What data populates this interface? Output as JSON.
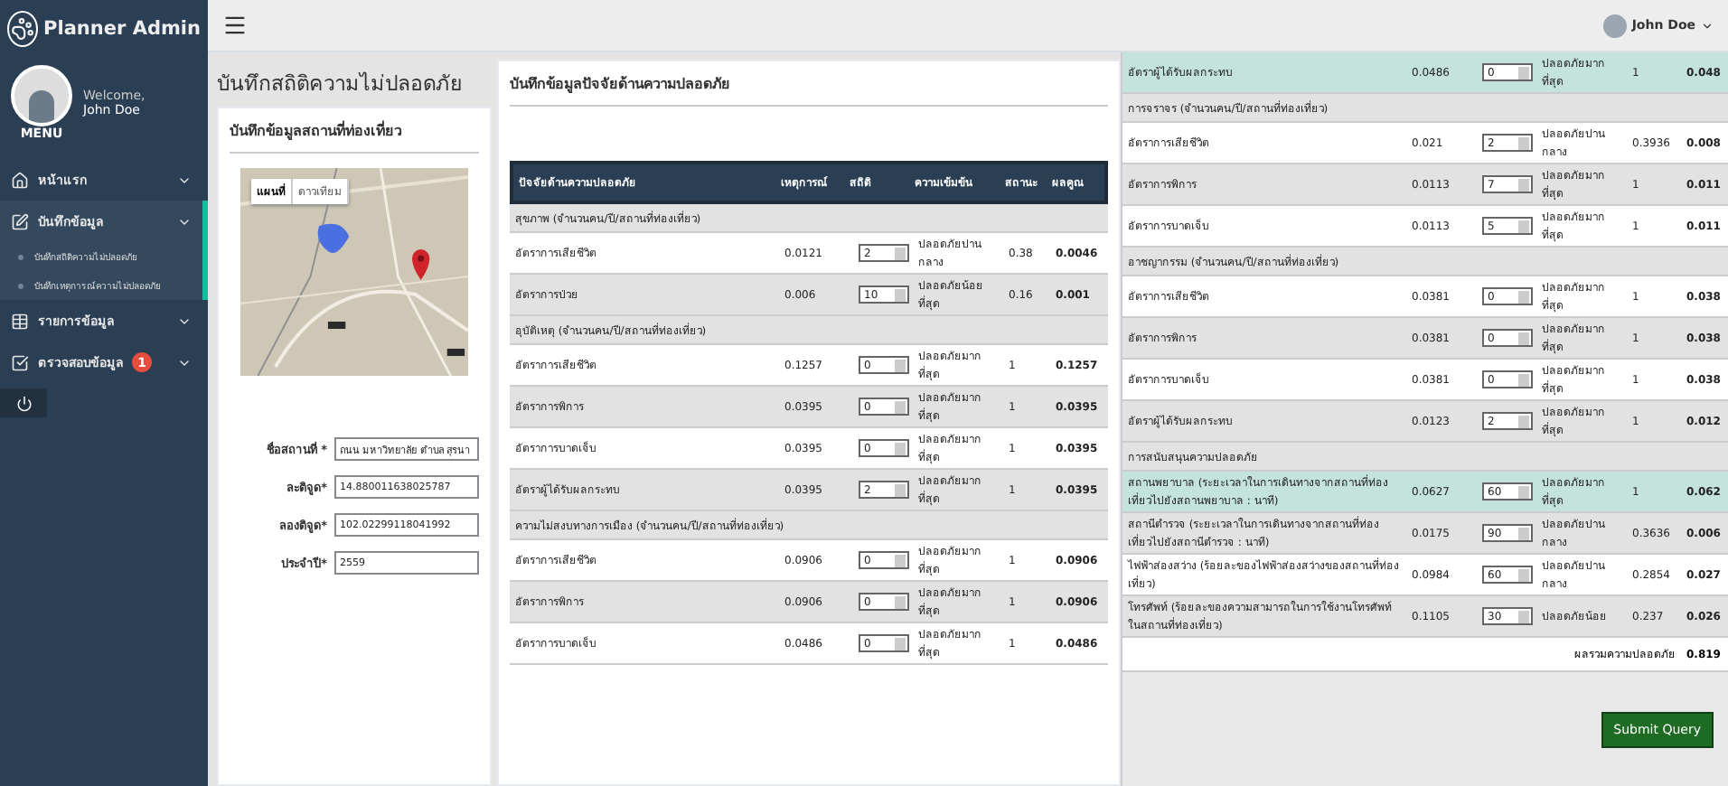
{
  "sidebar": {
    "brand": "Planner Admin",
    "welcome": "Welcome,",
    "user": "John Doe",
    "menu_label": "MENU",
    "items": [
      {
        "kind": "home",
        "label": "หน้าแรก",
        "selected": false
      },
      {
        "kind": "edit",
        "label": "บันทึกข้อมูล",
        "selected": true,
        "children": [
          {
            "label": "บันทึกสถิติความไม่ปลอดภัย"
          },
          {
            "label": "บันทึกเหตุการณ์ความไม่ปลอดภัย"
          }
        ]
      },
      {
        "kind": "table",
        "label": "รายการข้อมูล",
        "selected": false
      },
      {
        "kind": "check",
        "label": "ตรวจสอบข้อมูล",
        "badge": "1",
        "selected": false
      }
    ]
  },
  "topbar": {
    "user": "John Doe"
  },
  "page_title": "บันทึกสถิติความไม่ปลอดภัย",
  "location_card": {
    "title": "บันทึกข้อมูลสถานที่ท่องเที่ยว",
    "map": {
      "kind": "picture",
      "tabs": [
        {
          "label": "แผนที่",
          "selected": true
        },
        {
          "label": "ดาวเทียม",
          "selected": false
        }
      ]
    },
    "fields": [
      {
        "label": "ชื่อสถานที่ *",
        "value": "ถนน มหาวิทยาลัย ตำบล สุรนา"
      },
      {
        "label": "ละติจูด*",
        "value": "14.880011638025787"
      },
      {
        "label": "ลองติจูด*",
        "value": "102.02299118041992"
      },
      {
        "label": "ประจำปี*",
        "value": "2559"
      }
    ]
  },
  "factors_table": {
    "title": "บันทึกข้อมูลปัจจัยด้านความปลอดภัย",
    "columns": [
      "ปัจจัยด้านความปลอดภัย",
      "เหตุการณ์",
      "สถิติ",
      "ความเข้มข้น",
      "สถานะ",
      "ผลคูณ"
    ],
    "rows": [
      {
        "kind": "group",
        "label": "สุขภาพ (จำนวนคน/ปี/สถานที่ท่องเที่ยว)"
      },
      {
        "kind": "item",
        "factor": "อัตราการเสียชีวิต",
        "weight": "0.0121",
        "stat": "2",
        "intensity": "ปลอดภัยปานกลาง",
        "score": "0.38",
        "product": "0.0046",
        "highlighted": false
      },
      {
        "kind": "item",
        "factor": "อัตราการป่วย",
        "weight": "0.006",
        "stat": "10",
        "intensity": "ปลอดภัยน้อยที่สุด",
        "score": "0.16",
        "product": "0.001",
        "highlighted": false
      },
      {
        "kind": "group",
        "label": "อุบัติเหตุ (จำนวนคน/ปี/สถานที่ท่องเที่ยว)"
      },
      {
        "kind": "item",
        "factor": "อัตราการเสียชีวิต",
        "weight": "0.1257",
        "stat": "0",
        "intensity": "ปลอดภัยมากที่สุด",
        "score": "1",
        "product": "0.1257",
        "highlighted": false
      },
      {
        "kind": "item",
        "factor": "อัตราการพิการ",
        "weight": "0.0395",
        "stat": "0",
        "intensity": "ปลอดภัยมากที่สุด",
        "score": "1",
        "product": "0.0395",
        "highlighted": false
      },
      {
        "kind": "item",
        "factor": "อัตราการบาดเจ็บ",
        "weight": "0.0395",
        "stat": "0",
        "intensity": "ปลอดภัยมากที่สุด",
        "score": "1",
        "product": "0.0395",
        "highlighted": false
      },
      {
        "kind": "item",
        "factor": "อัตราผู้ได้รับผลกระทบ",
        "weight": "0.0395",
        "stat": "2",
        "intensity": "ปลอดภัยมากที่สุด",
        "score": "1",
        "product": "0.0395",
        "highlighted": false
      },
      {
        "kind": "group",
        "label": "ความไม่สงบทางการเมือง (จำนวนคน/ปี/สถานที่ท่องเที่ยว)"
      },
      {
        "kind": "item",
        "factor": "อัตราการเสียชีวิต",
        "weight": "0.0906",
        "stat": "0",
        "intensity": "ปลอดภัยมากที่สุด",
        "score": "1",
        "product": "0.0906",
        "highlighted": false
      },
      {
        "kind": "item",
        "factor": "อัตราการพิการ",
        "weight": "0.0906",
        "stat": "0",
        "intensity": "ปลอดภัยมากที่สุด",
        "score": "1",
        "product": "0.0906",
        "highlighted": false
      },
      {
        "kind": "item",
        "factor": "อัตราการบาดเจ็บ",
        "weight": "0.0486",
        "stat": "0",
        "intensity": "ปลอดภัยมากที่สุด",
        "score": "1",
        "product": "0.0486",
        "highlighted": false
      }
    ]
  },
  "factors_table_continued": {
    "rows": [
      {
        "kind": "item",
        "factor": "อัตราผู้ได้รับผลกระทบ",
        "weight": "0.0486",
        "stat": "0",
        "intensity": "ปลอดภัยมากที่สุด",
        "score": "1",
        "product": "0.048",
        "highlighted": true
      },
      {
        "kind": "group",
        "label": "การจราจร (จำนวนคน/ปี/สถานที่ท่องเที่ยว)"
      },
      {
        "kind": "item",
        "factor": "อัตราการเสียชีวิต",
        "weight": "0.021",
        "stat": "2",
        "intensity": "ปลอดภัยปานกลาง",
        "score": "0.3936",
        "product": "0.008",
        "highlighted": false
      },
      {
        "kind": "item",
        "factor": "อัตราการพิการ",
        "weight": "0.0113",
        "stat": "7",
        "intensity": "ปลอดภัยมากที่สุด",
        "score": "1",
        "product": "0.011",
        "highlighted": false
      },
      {
        "kind": "item",
        "factor": "อัตราการบาดเจ็บ",
        "weight": "0.0113",
        "stat": "5",
        "intensity": "ปลอดภัยมากที่สุด",
        "score": "1",
        "product": "0.011",
        "highlighted": false
      },
      {
        "kind": "group",
        "label": "อาชญากรรม (จำนวนคน/ปี/สถานที่ท่องเที่ยว)"
      },
      {
        "kind": "item",
        "factor": "อัตราการเสียชีวิต",
        "weight": "0.0381",
        "stat": "0",
        "intensity": "ปลอดภัยมากที่สุด",
        "score": "1",
        "product": "0.038",
        "highlighted": false
      },
      {
        "kind": "item",
        "factor": "อัตราการพิการ",
        "weight": "0.0381",
        "stat": "0",
        "intensity": "ปลอดภัยมากที่สุด",
        "score": "1",
        "product": "0.038",
        "highlighted": false
      },
      {
        "kind": "item",
        "factor": "อัตราการบาดเจ็บ",
        "weight": "0.0381",
        "stat": "0",
        "intensity": "ปลอดภัยมากที่สุด",
        "score": "1",
        "product": "0.038",
        "highlighted": false
      },
      {
        "kind": "item",
        "factor": "อัตราผู้ได้รับผลกระทบ",
        "weight": "0.0123",
        "stat": "2",
        "intensity": "ปลอดภัยมากที่สุด",
        "score": "1",
        "product": "0.012",
        "highlighted": false
      },
      {
        "kind": "group",
        "label": "การสนับสนุนความปลอดภัย"
      },
      {
        "kind": "item",
        "factor": "สถานพยาบาล (ระยะเวลาในการเดินทางจากสถานที่ท่องเที่ยวไปยังสถานพยาบาล : นาที)",
        "weight": "0.0627",
        "stat": "60",
        "intensity": "ปลอดภัยมากที่สุด",
        "score": "1",
        "product": "0.062",
        "highlighted": true
      },
      {
        "kind": "item",
        "factor": "สถานีตำรวจ (ระยะเวลาในการเดินทางจากสถานที่ท่องเที่ยวไปยังสถานีตำรวจ : นาที)",
        "weight": "0.0175",
        "stat": "90",
        "intensity": "ปลอดภัยปานกลาง",
        "score": "0.3636",
        "product": "0.006",
        "highlighted": false
      },
      {
        "kind": "item",
        "factor": "ไฟฟ้าส่องสว่าง (ร้อยละของไฟฟ้าส่องสว่างของสถานที่ท่องเที่ยว)",
        "weight": "0.0984",
        "stat": "60",
        "intensity": "ปลอดภัยปานกลาง",
        "score": "0.2854",
        "product": "0.027",
        "highlighted": false
      },
      {
        "kind": "item",
        "factor": "โทรศัพท์ (ร้อยละของความสามารถในการใช้งานโทรศัพท์ในสถานที่ท่องเที่ยว)",
        "weight": "0.1105",
        "stat": "30",
        "intensity": "ปลอดภัยน้อย",
        "score": "0.237",
        "product": "0.026",
        "highlighted": false
      }
    ],
    "total_label": "ผลรวมความปลอดภัย",
    "total": "0.819",
    "submit": "Submit Query"
  }
}
